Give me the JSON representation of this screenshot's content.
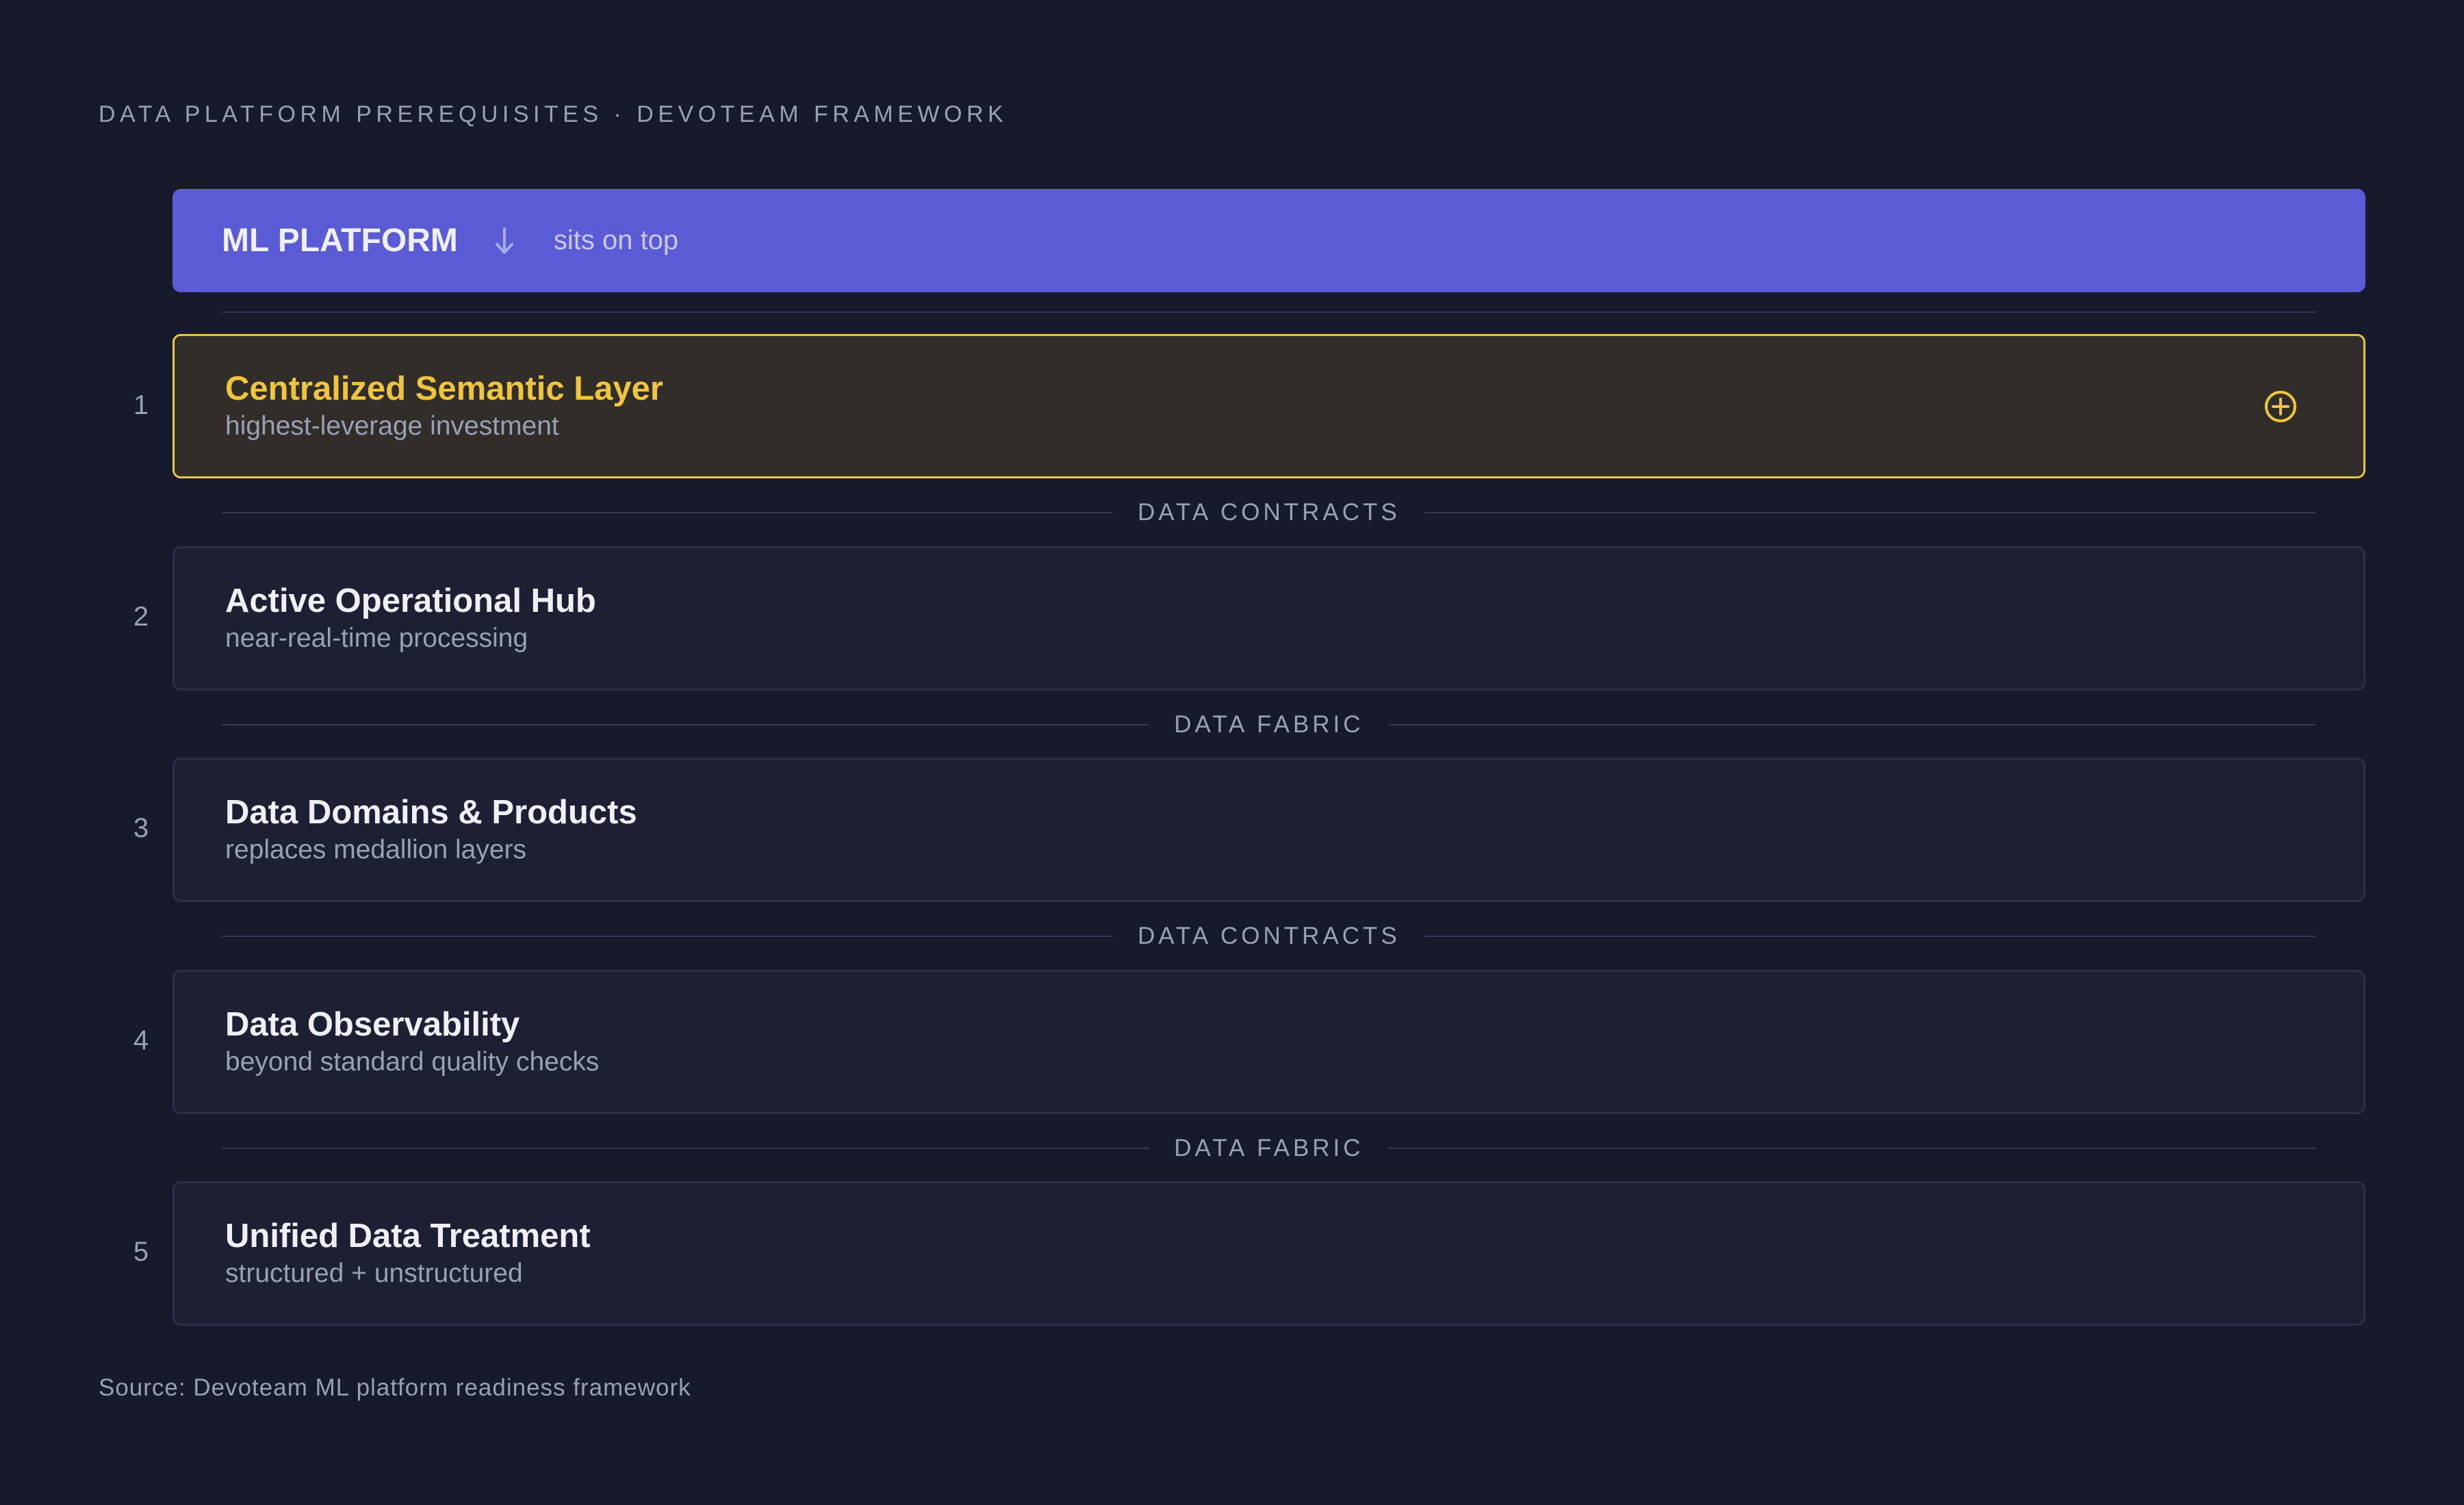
{
  "header": {
    "eyebrow": "DATA PLATFORM PREREQUISITES · DEVOTEAM FRAMEWORK"
  },
  "top_layer": {
    "title": "ML PLATFORM",
    "arrow_icon": "arrow-down-icon",
    "note": "sits on top"
  },
  "layers": [
    {
      "number": "1",
      "name": "Centralized Semantic Layer",
      "description": "highest-leverage investment",
      "highlighted": true,
      "icon": "plus-circle-icon"
    },
    {
      "number": "2",
      "name": "Active Operational Hub",
      "description": "near-real-time processing",
      "highlighted": false
    },
    {
      "number": "3",
      "name": "Data Domains & Products",
      "description": "replaces medallion layers",
      "highlighted": false
    },
    {
      "number": "4",
      "name": "Data Observability",
      "description": "beyond standard quality checks",
      "highlighted": false
    },
    {
      "number": "5",
      "name": "Unified Data Treatment",
      "description": "structured + unstructured",
      "highlighted": false
    }
  ],
  "separators": [
    "DATA CONTRACTS",
    "DATA FABRIC",
    "DATA CONTRACTS",
    "DATA FABRIC"
  ],
  "footer": {
    "source": "Source: Devoteam ML platform readiness framework"
  },
  "colors": {
    "background": "#161a2b",
    "ml_platform_bar": "#5b5bd6",
    "highlight_accent": "#f0c53c",
    "layer_card": "#1d2033",
    "muted_text": "#9aa0b4"
  }
}
